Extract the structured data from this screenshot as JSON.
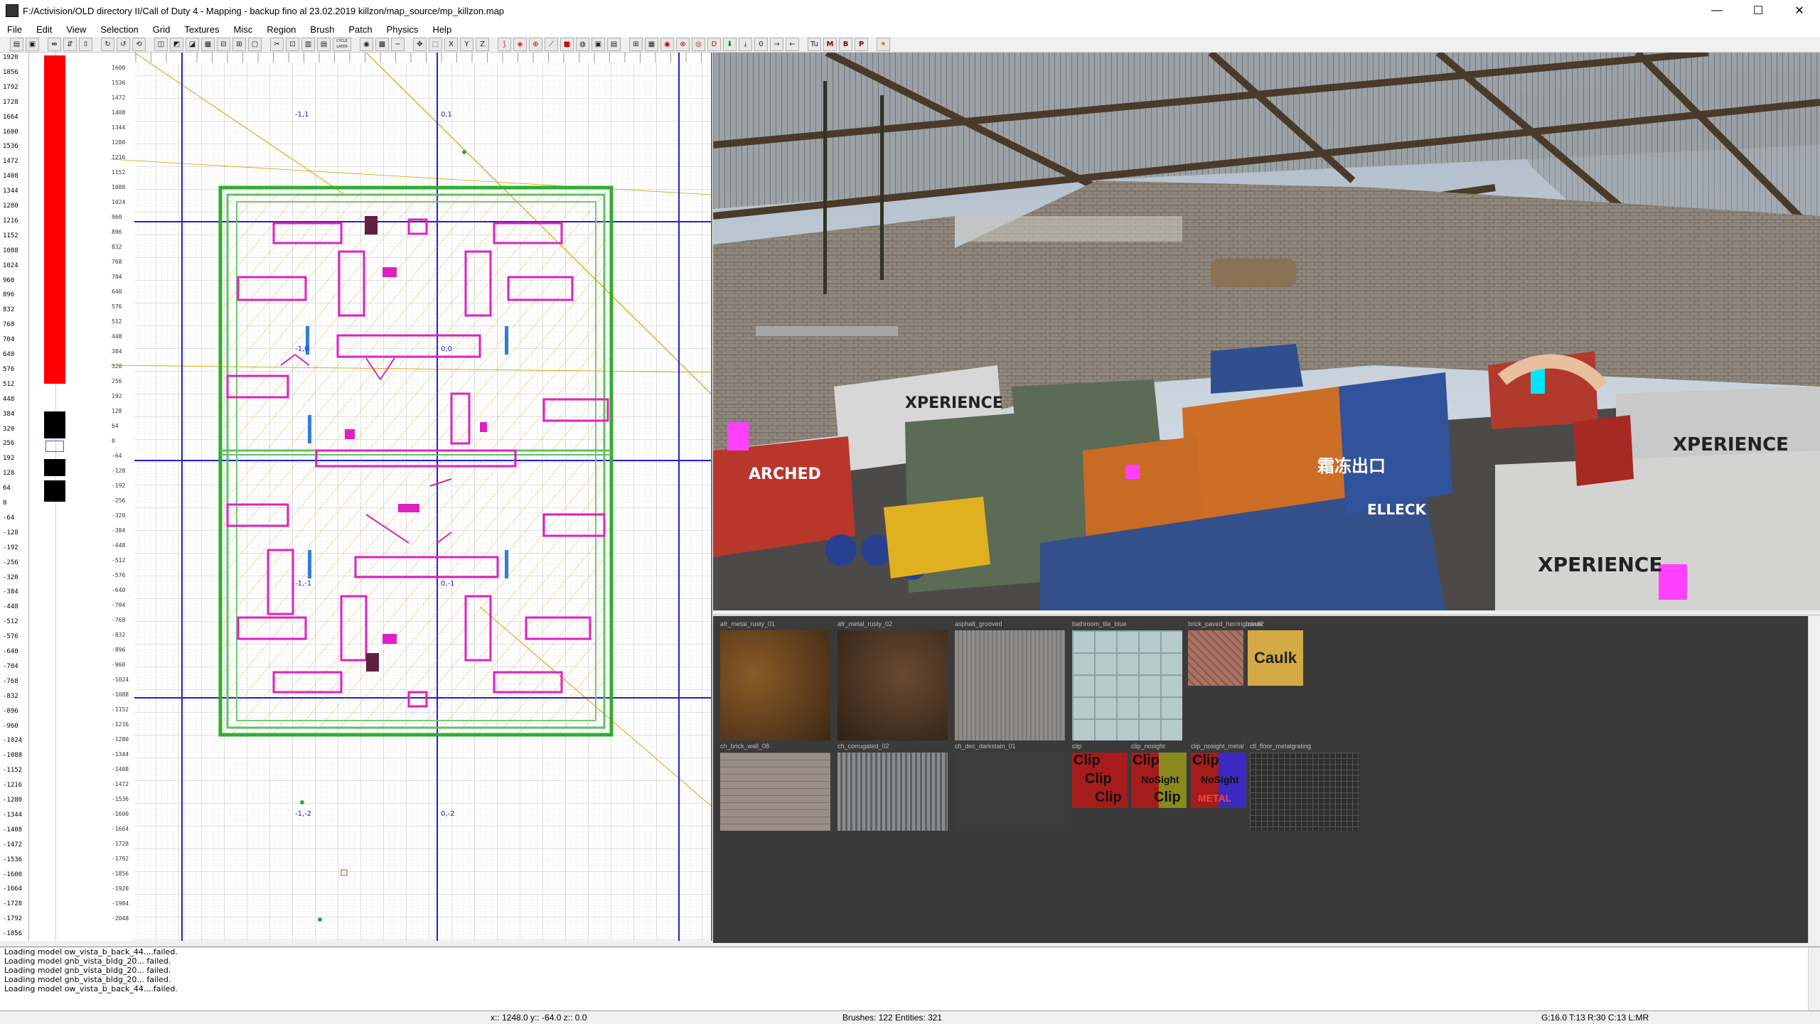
{
  "window": {
    "title": "F:/Activision/OLD directory II/Call of Duty 4 - Mapping  -  backup fino al 23.02.2019 killzon/map_source/mp_killzon.map",
    "minimize": "—",
    "maximize": "☐",
    "close": "✕"
  },
  "menu": [
    "File",
    "Edit",
    "View",
    "Selection",
    "Grid",
    "Textures",
    "Misc",
    "Region",
    "Brush",
    "Patch",
    "Physics",
    "Help"
  ],
  "toolbar": {
    "cycle_layer_label": "CYCLE LAYER",
    "letters": [
      "M",
      "B",
      "P"
    ]
  },
  "z_ruler": {
    "ticks": [
      "1920",
      "1856",
      "1792",
      "1728",
      "1664",
      "1600",
      "1536",
      "1472",
      "1408",
      "1344",
      "1280",
      "1216",
      "1152",
      "1088",
      "1024",
      "960",
      "896",
      "832",
      "768",
      "704",
      "640",
      "576",
      "512",
      "448",
      "384",
      "320",
      "256",
      "192",
      "128",
      "64",
      "0",
      "-64",
      "-128",
      "-192",
      "-256",
      "-320",
      "-384",
      "-448",
      "-512",
      "-576",
      "-640",
      "-704",
      "-768",
      "-832",
      "-896",
      "-960",
      "-1024",
      "-1088",
      "-1152",
      "-1216",
      "-1280",
      "-1344",
      "-1408",
      "-1472",
      "-1536",
      "-1600",
      "-1664",
      "-1728",
      "-1792",
      "-1856"
    ]
  },
  "grid_view": {
    "left_ticks": [
      "1600",
      "1536",
      "1472",
      "1408",
      "1344",
      "1280",
      "1216",
      "1152",
      "1088",
      "1024",
      "960",
      "896",
      "832",
      "768",
      "704",
      "640",
      "576",
      "512",
      "448",
      "384",
      "320",
      "256",
      "192",
      "128",
      "64",
      "0",
      "-64",
      "-128",
      "-192",
      "-256",
      "-320",
      "-384",
      "-448",
      "-512",
      "-576",
      "-640",
      "-704",
      "-768",
      "-832",
      "-896",
      "-960",
      "-1024",
      "-1088",
      "-1152",
      "-1216",
      "-1280",
      "-1344",
      "-1408",
      "-1472",
      "-1536",
      "-1600",
      "-1664",
      "-1728",
      "-1792",
      "-1856",
      "-1920",
      "-1984",
      "-2048"
    ],
    "region_labels": [
      "-1,1",
      "0,1",
      "-1,0",
      "0,0",
      "-1,-1",
      "0,-1",
      "-1,-2",
      "0,-2"
    ]
  },
  "textures": [
    {
      "name": "afr_metal_rusty_01",
      "color": "#5a3a1e"
    },
    {
      "name": "afr_metal_rusty_02",
      "color": "#4a3422"
    },
    {
      "name": "asphalt_grooved",
      "color": "#8a8886"
    },
    {
      "name": "bathroom_tile_blue",
      "color": "#b7cbcd"
    },
    {
      "name": "brick_paved_herringbone2",
      "color": "#9c6a5c"
    },
    {
      "name": "caulk",
      "color": "#d3a944"
    },
    {
      "name": "ch_brick_wall_08",
      "color": "#9a8f86"
    },
    {
      "name": "ch_corrugated_02",
      "color": "#7a7c7e"
    },
    {
      "name": "ch_dec_darkstain_01",
      "color": "#3c3c3c"
    },
    {
      "name": "clip",
      "color": "#a61c1c"
    },
    {
      "name": "clip_nosight",
      "color": "#a61c1c"
    },
    {
      "name": "clip_nosight_metal",
      "color": "#a61c1c"
    },
    {
      "name": "ctl_floor_metalgrating",
      "color": "#2e2e2e"
    }
  ],
  "texture_text": {
    "caulk": "Caulk",
    "clip": "Clip",
    "nosight": "NoSight",
    "metal": "METAL"
  },
  "console": [
    "Loading model ow_vista_b_back_44....failed.",
    "Loading model gnb_vista_bldg_20... failed.",
    "Loading model gnb_vista_bldg_20... failed.",
    "Loading model gnb_vista_bldg_20... failed.",
    "Loading model ow_vista_b_back_44....failed."
  ],
  "status": {
    "coords": "x:: 1248.0  y:: -64.0  z:: 0.0",
    "counts": "Brushes: 122 Entities: 321",
    "grid": "G:16.0 T:13 R:30 C:13 L:MR"
  },
  "scene_text": {
    "experience": "XPERIENCE",
    "arched": "ARCHED",
    "chinese": "霜冻出口",
    "bullock": "ELLECK"
  }
}
